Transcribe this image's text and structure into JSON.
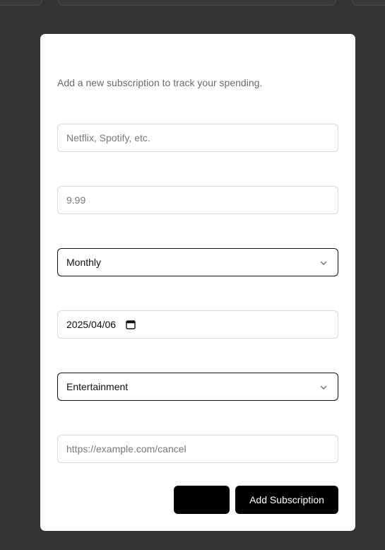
{
  "dialog": {
    "description": "Add a new subscription to track your spending.",
    "fields": {
      "name": {
        "placeholder": "Netflix, Spotify, etc.",
        "value": ""
      },
      "price": {
        "placeholder": "9.99",
        "value": ""
      },
      "billing_cycle": {
        "value": "Monthly"
      },
      "start_date": {
        "value": "2025/04/06"
      },
      "category": {
        "value": "Entertainment"
      },
      "cancel_url": {
        "placeholder": "https://example.com/cancel",
        "value": ""
      }
    },
    "buttons": {
      "cancel_label": "",
      "submit_label": "Add Subscription"
    }
  },
  "colors": {
    "backdrop": "#333333",
    "modal": "#ffffff",
    "button": "#000000",
    "muted_text": "#6b6b6b",
    "border": "#d9d9d9"
  },
  "icons": {
    "select": "chevron-down-icon",
    "date": "calendar-icon"
  }
}
